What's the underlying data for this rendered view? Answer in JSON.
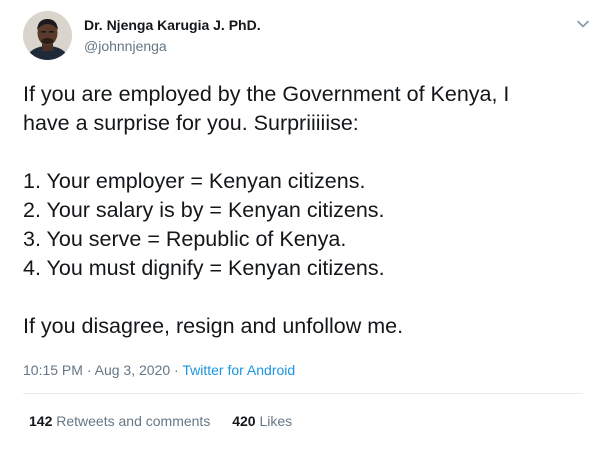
{
  "author": {
    "name": "Dr. Njenga Karugia J. PhD.",
    "handle": "@johnnjenga"
  },
  "tweet": {
    "lines": [
      "If you are employed by the Government of Kenya, I",
      "have a surprise for you. Surpriiiiise:",
      "1. Your employer = Kenyan citizens.",
      "2. Your salary is by = Kenyan citizens.",
      "3. You serve = Republic of Kenya.",
      "4. You must dignify = Kenyan citizens.",
      "If you disagree, resign and unfollow me."
    ]
  },
  "meta": {
    "time": "10:15 PM",
    "separator": "·",
    "date": "Aug 3, 2020",
    "source": "Twitter for Android"
  },
  "stats": {
    "retweets_count": "142",
    "retweets_label": "Retweets and comments",
    "likes_count": "420",
    "likes_label": "Likes"
  },
  "icons": {
    "menu": "chevron-down-icon",
    "avatar": "profile-photo"
  },
  "colors": {
    "text": "#14171a",
    "secondary": "#657786",
    "link": "#1b95e0",
    "divider": "#e6ecf0"
  }
}
